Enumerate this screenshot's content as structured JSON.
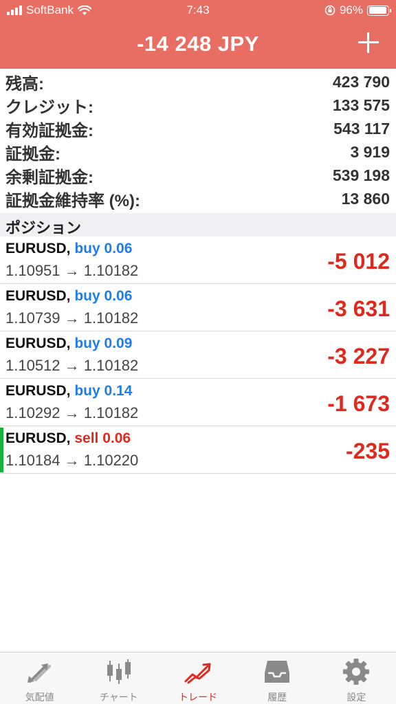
{
  "status_bar": {
    "carrier": "SoftBank",
    "time": "7:43",
    "battery": "96%",
    "battery_level": 0.96
  },
  "header": {
    "title": "-14 248 JPY",
    "add_icon": "plus-icon"
  },
  "summary": [
    {
      "label": "残高:",
      "value": "423 790"
    },
    {
      "label": "クレジット:",
      "value": "133 575"
    },
    {
      "label": "有効証拠金:",
      "value": "543 117"
    },
    {
      "label": "証拠金:",
      "value": "3 919"
    },
    {
      "label": "余剰証拠金:",
      "value": "539 198"
    },
    {
      "label": "証拠金維持率 (%):",
      "value": "13 860"
    }
  ],
  "positions_section": {
    "title": "ポジション"
  },
  "positions": [
    {
      "symbol": "EURUSD,",
      "type": "buy",
      "volume": "0.06",
      "prices": "1.10951 → 1.10182",
      "profit": "-5 012"
    },
    {
      "symbol": "EURUSD,",
      "type": "buy",
      "volume": "0.06",
      "prices": "1.10739 → 1.10182",
      "profit": "-3 631"
    },
    {
      "symbol": "EURUSD,",
      "type": "buy",
      "volume": "0.09",
      "prices": "1.10512 → 1.10182",
      "profit": "-3 227"
    },
    {
      "symbol": "EURUSD,",
      "type": "buy",
      "volume": "0.14",
      "prices": "1.10292 → 1.10182",
      "profit": "-1 673"
    },
    {
      "symbol": "EURUSD,",
      "type": "sell",
      "volume": "0.06",
      "prices": "1.10184 → 1.10220",
      "profit": "-235",
      "selected": true
    }
  ],
  "tabs": [
    {
      "label": "気配値",
      "icon": "quotes-arrows-icon",
      "active": false
    },
    {
      "label": "チャート",
      "icon": "candlestick-chart-icon",
      "active": false
    },
    {
      "label": "トレード",
      "icon": "trade-trend-icon",
      "active": true
    },
    {
      "label": "履歴",
      "icon": "history-inbox-icon",
      "active": false
    },
    {
      "label": "設定",
      "icon": "gear-icon",
      "active": false
    }
  ],
  "colors": {
    "header_bg": "#e86e63",
    "buy": "#1f7de8",
    "sell": "#e0281c",
    "loss": "#e0281c",
    "selected_marker": "#19b33b",
    "tab_active": "#e0281c",
    "tab_inactive": "#8a8a8a"
  }
}
